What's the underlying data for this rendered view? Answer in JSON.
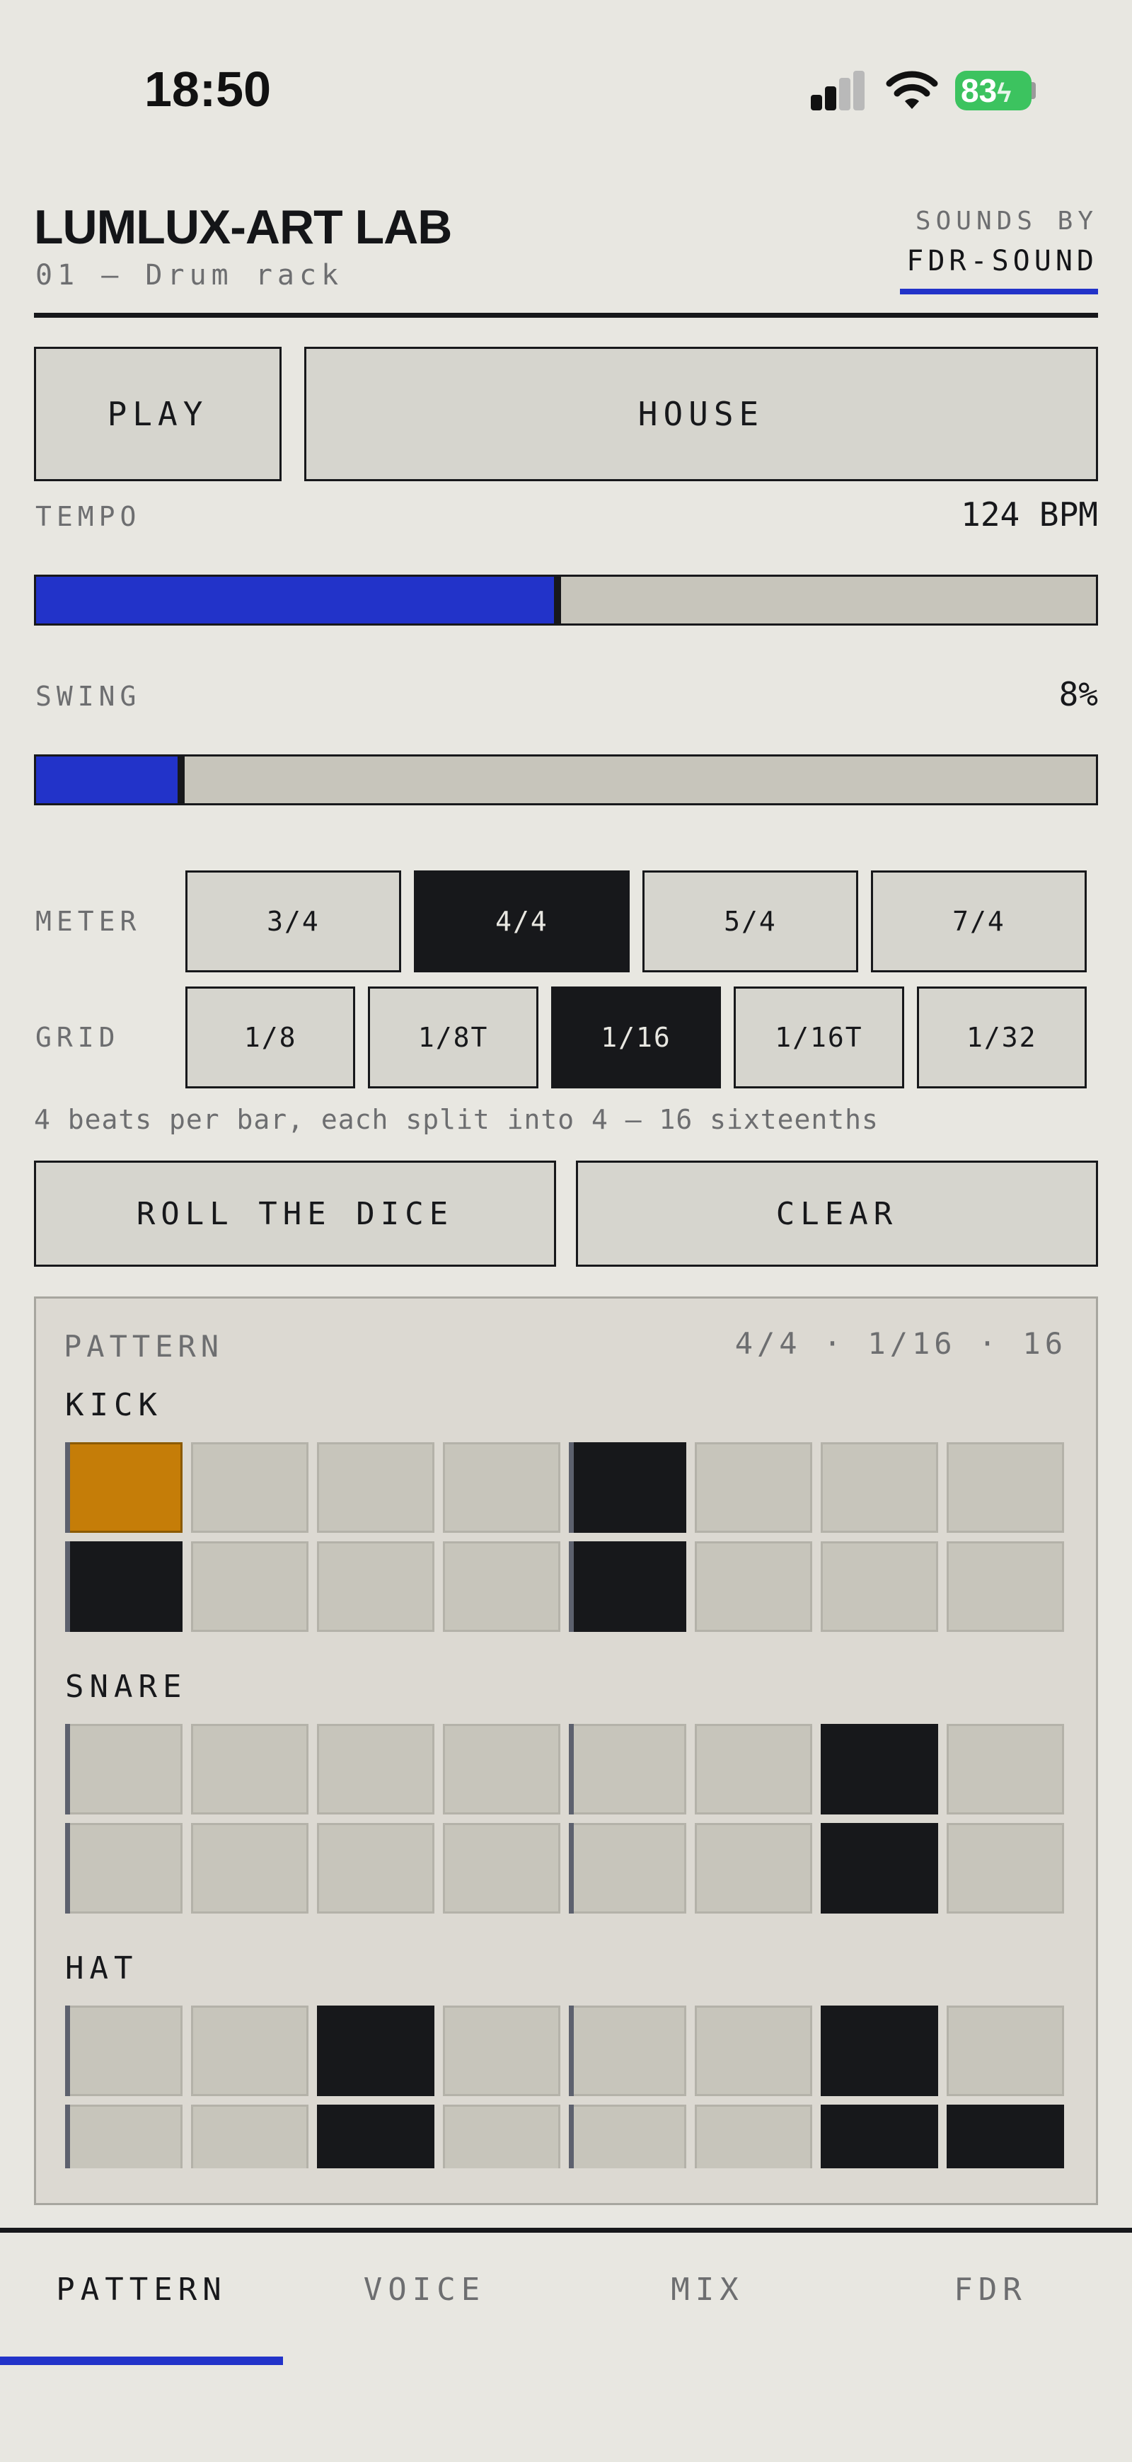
{
  "status_bar": {
    "time": "18:50",
    "battery": "83"
  },
  "header": {
    "title": "LUMLUX-ART LAB",
    "subtitle": "01 — Drum rack",
    "sounds_by_label": "SOUNDS BY",
    "brand": "FDR-SOUND"
  },
  "controls": {
    "play_label": "PLAY",
    "genre_label": "HOUSE",
    "tempo": {
      "label": "TEMPO",
      "value": "124 BPM",
      "level": 0.49
    },
    "swing": {
      "label": "SWING",
      "value": "8%",
      "level": 0.135
    },
    "meter": {
      "label": "METER",
      "options": [
        "3/4",
        "4/4",
        "5/4",
        "7/4"
      ],
      "selected": "4/4"
    },
    "grid": {
      "label": "GRID",
      "options": [
        "1/8",
        "1/8T",
        "1/16",
        "1/16T",
        "1/32"
      ],
      "selected": "1/16"
    },
    "note": "4 beats per bar, each split into 4 — 16 sixteenths",
    "roll_label": "ROLL THE DICE",
    "clear_label": "CLEAR"
  },
  "pattern": {
    "label": "PATTERN",
    "info": "4/4 · 1/16 · 16",
    "tracks": [
      {
        "name": "KICK",
        "steps": [
          1,
          0,
          0,
          0,
          1,
          0,
          0,
          0,
          1,
          0,
          0,
          0,
          1,
          0,
          0,
          0
        ]
      },
      {
        "name": "SNARE",
        "steps": [
          0,
          0,
          0,
          0,
          0,
          0,
          1,
          0,
          0,
          0,
          0,
          0,
          0,
          0,
          1,
          0
        ]
      },
      {
        "name": "HAT",
        "steps": [
          0,
          0,
          1,
          0,
          0,
          0,
          1,
          0,
          0,
          0,
          1,
          0,
          0,
          0,
          1,
          1
        ]
      }
    ],
    "current_step": 0
  },
  "tabs": [
    "PATTERN",
    "VOICE",
    "MIX",
    "FDR"
  ],
  "active_tab": "PATTERN",
  "colors": {
    "accent": "#2233c9",
    "playhead": "#c57d08",
    "ink": "#17181b",
    "background": "#e8e7e1"
  }
}
